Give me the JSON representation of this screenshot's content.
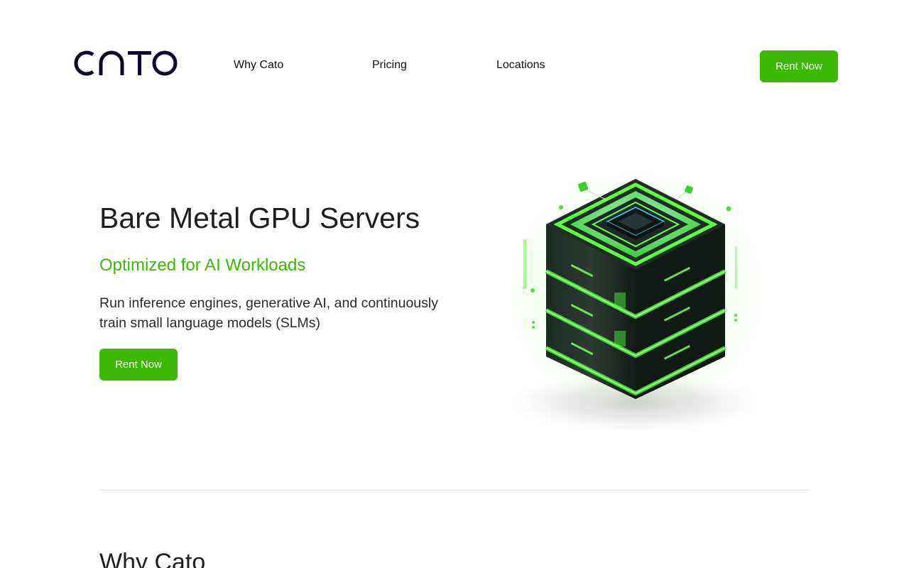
{
  "brand": {
    "logo_text": "cato",
    "accent_color": "#3cb805",
    "logo_color": "#0c0a2a"
  },
  "nav": {
    "items": [
      {
        "label": "Why Cato"
      },
      {
        "label": "Pricing"
      },
      {
        "label": "Locations"
      }
    ],
    "cta_label": "Rent Now"
  },
  "hero": {
    "title": "Bare Metal GPU Servers",
    "subtitle": "Optimized for AI Workloads",
    "description": "Run inference engines, generative AI, and continuously train small language models (SLMs)",
    "cta_label": "Rent Now",
    "image_icon": "gpu-server-stack-icon"
  },
  "section": {
    "title": "Why Cato"
  }
}
